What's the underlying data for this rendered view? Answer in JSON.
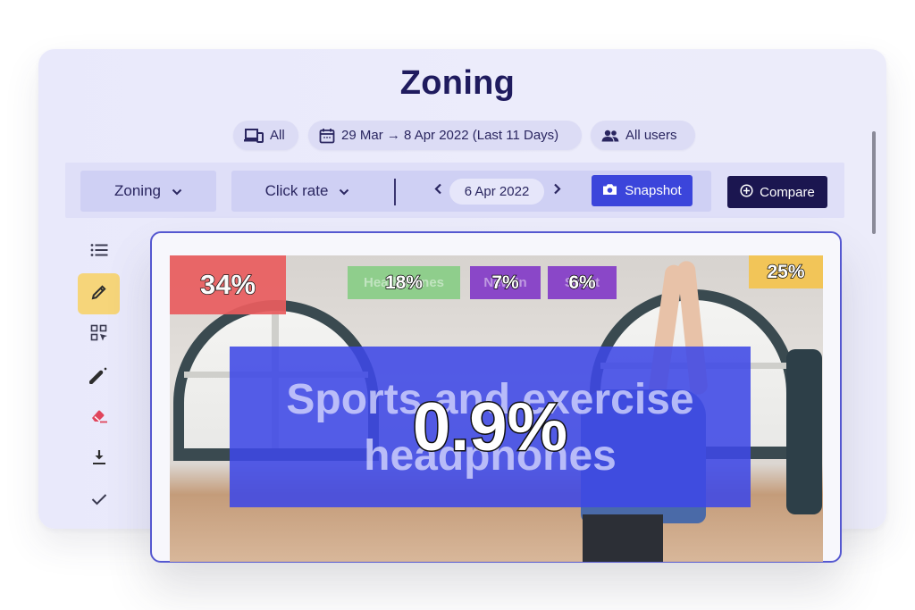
{
  "page": {
    "title": "Zoning"
  },
  "filters": {
    "device": {
      "icon": "devices-icon",
      "label": "All"
    },
    "date_range": {
      "icon": "calendar-icon",
      "label": "29 Mar → 8 Apr 2022 (Last 11 Days)"
    },
    "segment": {
      "icon": "users-icon",
      "label": "All users"
    }
  },
  "toolbar": {
    "mode_dropdown": {
      "label": "Zoning",
      "icon": "chevron-down-icon"
    },
    "metric_dropdown": {
      "label": "Click rate",
      "icon": "chevron-down-icon"
    },
    "date": {
      "prev_icon": "chevron-left-icon",
      "value": "6 Apr 2022",
      "next_icon": "chevron-right-icon"
    },
    "snapshot_button": {
      "icon": "camera-icon",
      "label": "Snapshot"
    },
    "compare_button": {
      "icon": "plus-circle-icon",
      "label": "Compare"
    }
  },
  "side_tools": [
    {
      "name": "list",
      "icon": "list-icon",
      "active": false
    },
    {
      "name": "edit",
      "icon": "pencil-icon",
      "active": true
    },
    {
      "name": "zone-select",
      "icon": "grid-select-icon",
      "active": false
    },
    {
      "name": "magic-wand",
      "icon": "magic-wand-icon",
      "active": false
    },
    {
      "name": "eraser",
      "icon": "eraser-icon",
      "active": false,
      "color": "#e0455c"
    },
    {
      "name": "download",
      "icon": "download-icon",
      "active": false
    },
    {
      "name": "validate",
      "icon": "check-icon",
      "active": false
    }
  ],
  "zones": [
    {
      "label": "",
      "value": "34%",
      "color": "#ea5d5f"
    },
    {
      "label": "Headphones",
      "value": "18%",
      "color": "#8fce8c"
    },
    {
      "label": "New In",
      "value": "7%",
      "color": "#8a47c8"
    },
    {
      "label": "Sport",
      "value": "6%",
      "color": "#8a47c8"
    },
    {
      "label": "",
      "value": "25%",
      "color": "#f2c558"
    },
    {
      "label": "Sports and exercise headphones",
      "value": "0.9%",
      "color": "#3d48e6"
    }
  ],
  "colors": {
    "accent": "#3b45db",
    "dark": "#1b1650",
    "active_tool": "#f6d57a",
    "card_border": "#5558d0"
  }
}
